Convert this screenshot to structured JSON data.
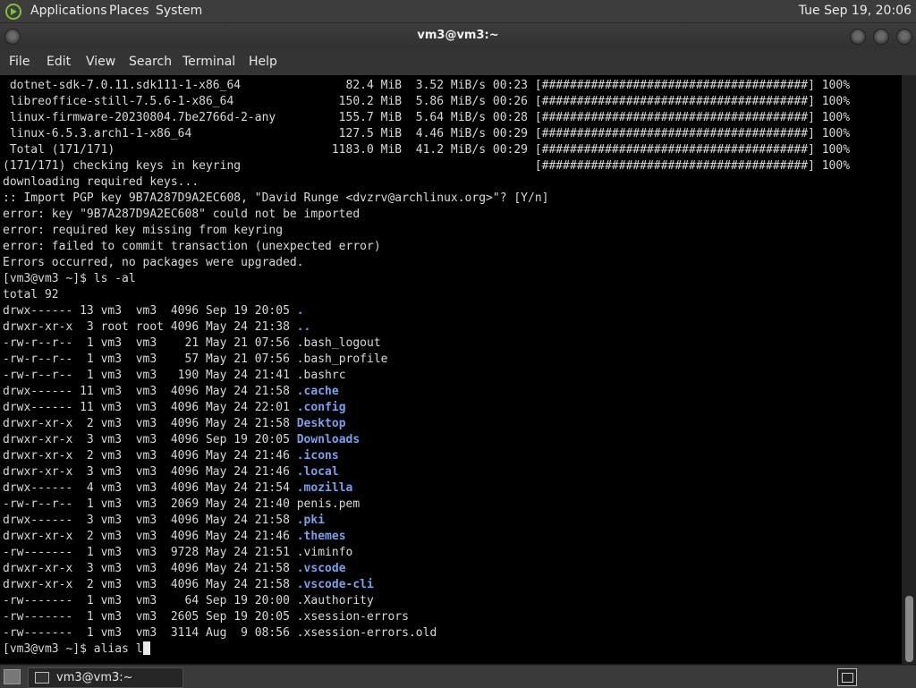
{
  "top_panel": {
    "menus": [
      "Applications",
      "Places",
      "System"
    ],
    "clock": "Tue Sep 19, 20:06"
  },
  "window": {
    "title": "vm3@vm3:~",
    "menubar": [
      "File",
      "Edit",
      "View",
      "Search",
      "Terminal",
      "Help"
    ]
  },
  "terminal": {
    "lines": [
      " dotnet-sdk-7.0.11.sdk111-1-x86_64               82.4 MiB  3.52 MiB/s 00:23 [######################################] 100%",
      " libreoffice-still-7.5.6-1-x86_64               150.2 MiB  5.86 MiB/s 00:26 [######################################] 100%",
      " linux-firmware-20230804.7be2766d-2-any         155.7 MiB  5.64 MiB/s 00:28 [######################################] 100%",
      " linux-6.5.3.arch1-1-x86_64                     127.5 MiB  4.46 MiB/s 00:29 [######################################] 100%",
      " Total (171/171)                               1183.0 MiB  41.2 MiB/s 00:29 [######################################] 100%",
      "(171/171) checking keys in keyring                                          [######################################] 100%",
      "downloading required keys...",
      ":: Import PGP key 9B7A287D9A2EC608, \"David Runge <dvzrv@archlinux.org>\"? [Y/n]",
      "error: key \"9B7A287D9A2EC608\" could not be imported",
      "error: required key missing from keyring",
      "error: failed to commit transaction (unexpected error)",
      "Errors occurred, no packages were upgraded.",
      "[vm3@vm3 ~]$ ls -al",
      "total 92"
    ],
    "listing": [
      {
        "perms": "drwx------ 13 vm3  vm3  4096 Sep 19 20:05 ",
        "name": ".",
        "dir": true
      },
      {
        "perms": "drwxr-xr-x  3 root root 4096 May 24 21:38 ",
        "name": "..",
        "dir": true
      },
      {
        "perms": "-rw-r--r--  1 vm3  vm3    21 May 21 07:56 ",
        "name": ".bash_logout",
        "dir": false
      },
      {
        "perms": "-rw-r--r--  1 vm3  vm3    57 May 21 07:56 ",
        "name": ".bash_profile",
        "dir": false
      },
      {
        "perms": "-rw-r--r--  1 vm3  vm3   190 May 24 21:41 ",
        "name": ".bashrc",
        "dir": false
      },
      {
        "perms": "drwx------ 11 vm3  vm3  4096 May 24 21:58 ",
        "name": ".cache",
        "dir": true
      },
      {
        "perms": "drwx------ 11 vm3  vm3  4096 May 24 22:01 ",
        "name": ".config",
        "dir": true
      },
      {
        "perms": "drwxr-xr-x  2 vm3  vm3  4096 May 24 21:58 ",
        "name": "Desktop",
        "dir": true
      },
      {
        "perms": "drwxr-xr-x  3 vm3  vm3  4096 Sep 19 20:05 ",
        "name": "Downloads",
        "dir": true
      },
      {
        "perms": "drwxr-xr-x  2 vm3  vm3  4096 May 24 21:46 ",
        "name": ".icons",
        "dir": true
      },
      {
        "perms": "drwxr-xr-x  3 vm3  vm3  4096 May 24 21:46 ",
        "name": ".local",
        "dir": true
      },
      {
        "perms": "drwx------  4 vm3  vm3  4096 May 24 21:54 ",
        "name": ".mozilla",
        "dir": true
      },
      {
        "perms": "-rw-r--r--  1 vm3  vm3  2069 May 24 21:40 ",
        "name": "penis.pem",
        "dir": false
      },
      {
        "perms": "drwx------  3 vm3  vm3  4096 May 24 21:58 ",
        "name": ".pki",
        "dir": true
      },
      {
        "perms": "drwxr-xr-x  2 vm3  vm3  4096 May 24 21:46 ",
        "name": ".themes",
        "dir": true
      },
      {
        "perms": "-rw-------  1 vm3  vm3  9728 May 24 21:51 ",
        "name": ".viminfo",
        "dir": false
      },
      {
        "perms": "drwxr-xr-x  3 vm3  vm3  4096 May 24 21:58 ",
        "name": ".vscode",
        "dir": true
      },
      {
        "perms": "drwxr-xr-x  2 vm3  vm3  4096 May 24 21:58 ",
        "name": ".vscode-cli",
        "dir": true
      },
      {
        "perms": "-rw-------  1 vm3  vm3    64 Sep 19 20:00 ",
        "name": ".Xauthority",
        "dir": false
      },
      {
        "perms": "-rw-------  1 vm3  vm3  2605 Sep 19 20:05 ",
        "name": ".xsession-errors",
        "dir": false
      },
      {
        "perms": "-rw-------  1 vm3  vm3  3114 Aug  9 08:56 ",
        "name": ".xsession-errors.old",
        "dir": false
      }
    ],
    "prompt_line": "[vm3@vm3 ~]$ alias l",
    "colors": {
      "foreground": "#d8d8d8",
      "directory": "#7c9fe6",
      "background": "#000000"
    }
  },
  "taskbar": {
    "task_label": "vm3@vm3:~"
  }
}
